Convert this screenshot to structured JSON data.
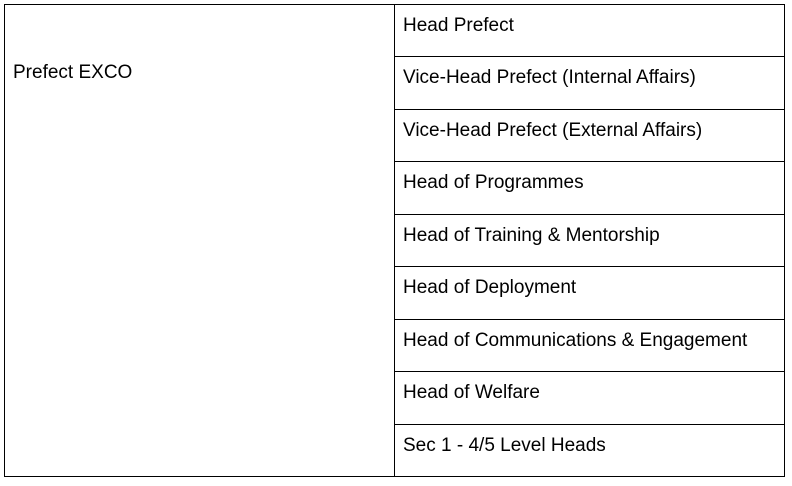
{
  "table": {
    "group_label": "Prefect EXCO",
    "roles": [
      "Head Prefect",
      "Vice-Head Prefect (Internal Affairs)",
      "Vice-Head Prefect (External Affairs)",
      "Head of Programmes",
      "Head of Training & Mentorship",
      "Head of Deployment",
      "Head of Communications & Engagement",
      "Head of Welfare",
      "Sec 1 - 4/5 Level Heads"
    ]
  }
}
